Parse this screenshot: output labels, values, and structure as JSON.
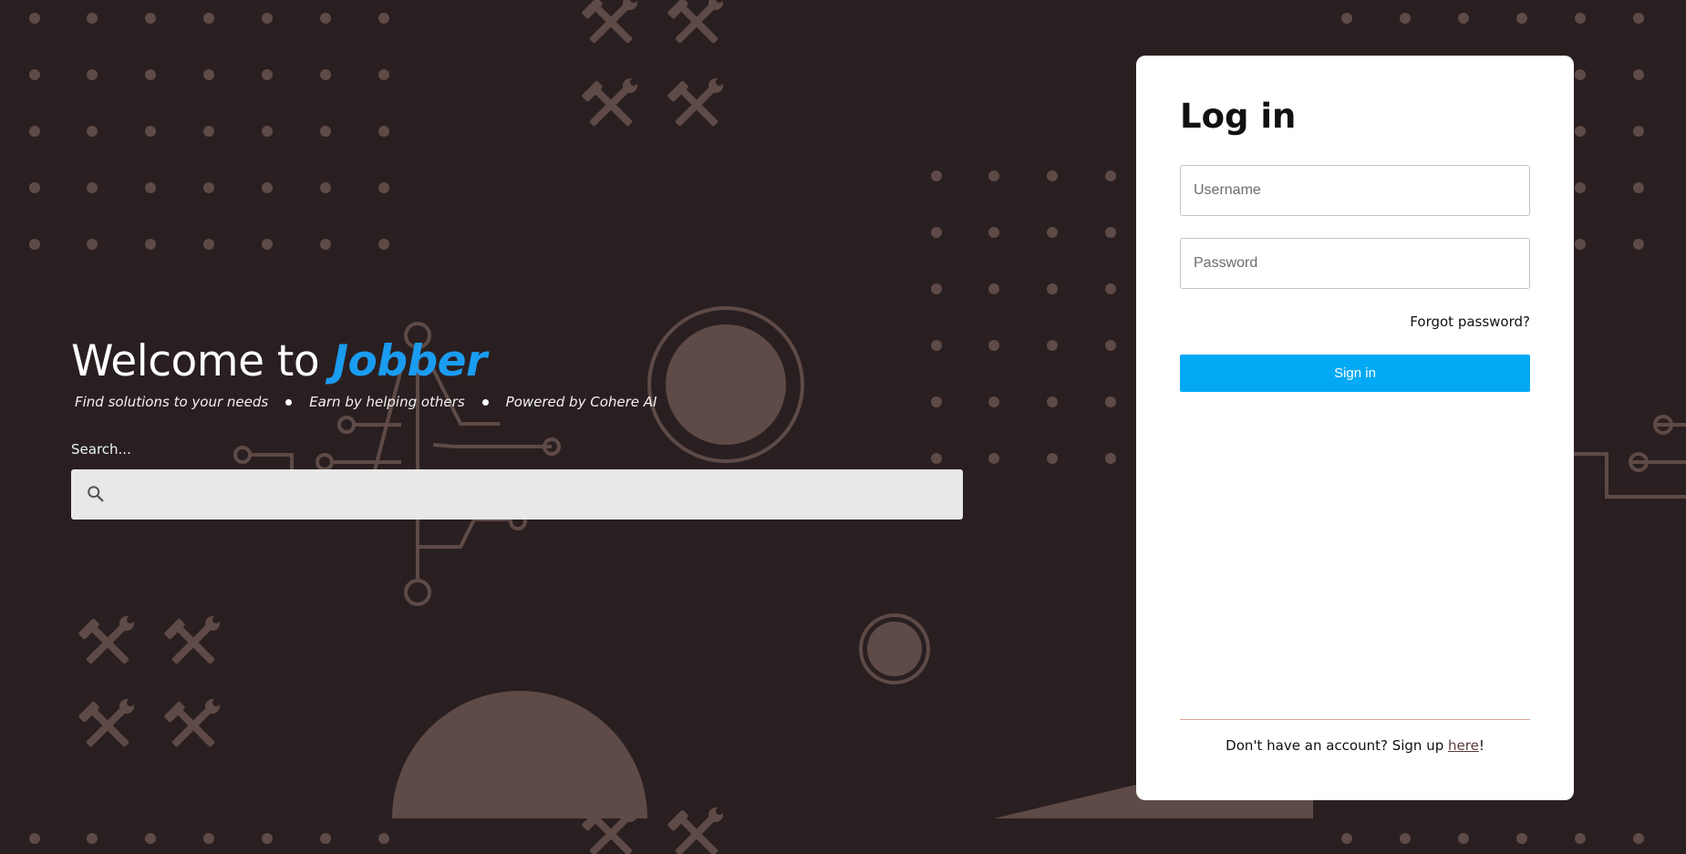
{
  "hero": {
    "title_prefix": "Welcome to ",
    "brand": "Jobber",
    "taglines": [
      "Find solutions to your needs",
      "Earn by helping others",
      "Powered by Cohere AI"
    ]
  },
  "search": {
    "label": "Search...",
    "value": "",
    "icon": "search-icon"
  },
  "login": {
    "title": "Log in",
    "username_placeholder": "Username",
    "password_placeholder": "Password",
    "forgot_label": "Forgot password?",
    "signin_label": "Sign in",
    "signup_prefix": "Don't have an account? Sign up ",
    "signup_link": "here",
    "signup_suffix": "!"
  },
  "colors": {
    "background": "#2a1f20",
    "decoration": "#5e4a46",
    "brand": "#1a9cf0",
    "button": "#03a9f4",
    "card": "#ffffff"
  },
  "decor_icons": [
    "hammer-wrench-icon",
    "circuit-lines",
    "dot-grid"
  ]
}
